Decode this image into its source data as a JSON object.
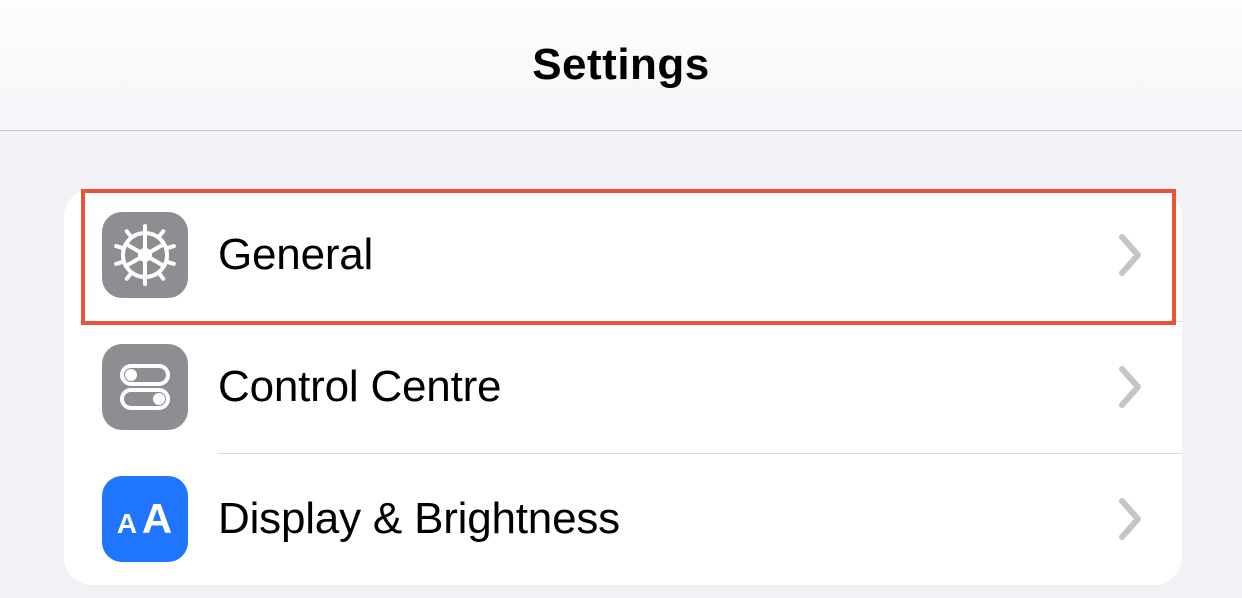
{
  "header": {
    "title": "Settings"
  },
  "rows": {
    "general": {
      "label": "General",
      "iconBg": "icon-gray"
    },
    "control": {
      "label": "Control Centre",
      "iconBg": "icon-gray"
    },
    "display": {
      "label": "Display & Brightness",
      "iconBg": "icon-blue"
    }
  },
  "highlight": {
    "target": "settings-row-general"
  }
}
